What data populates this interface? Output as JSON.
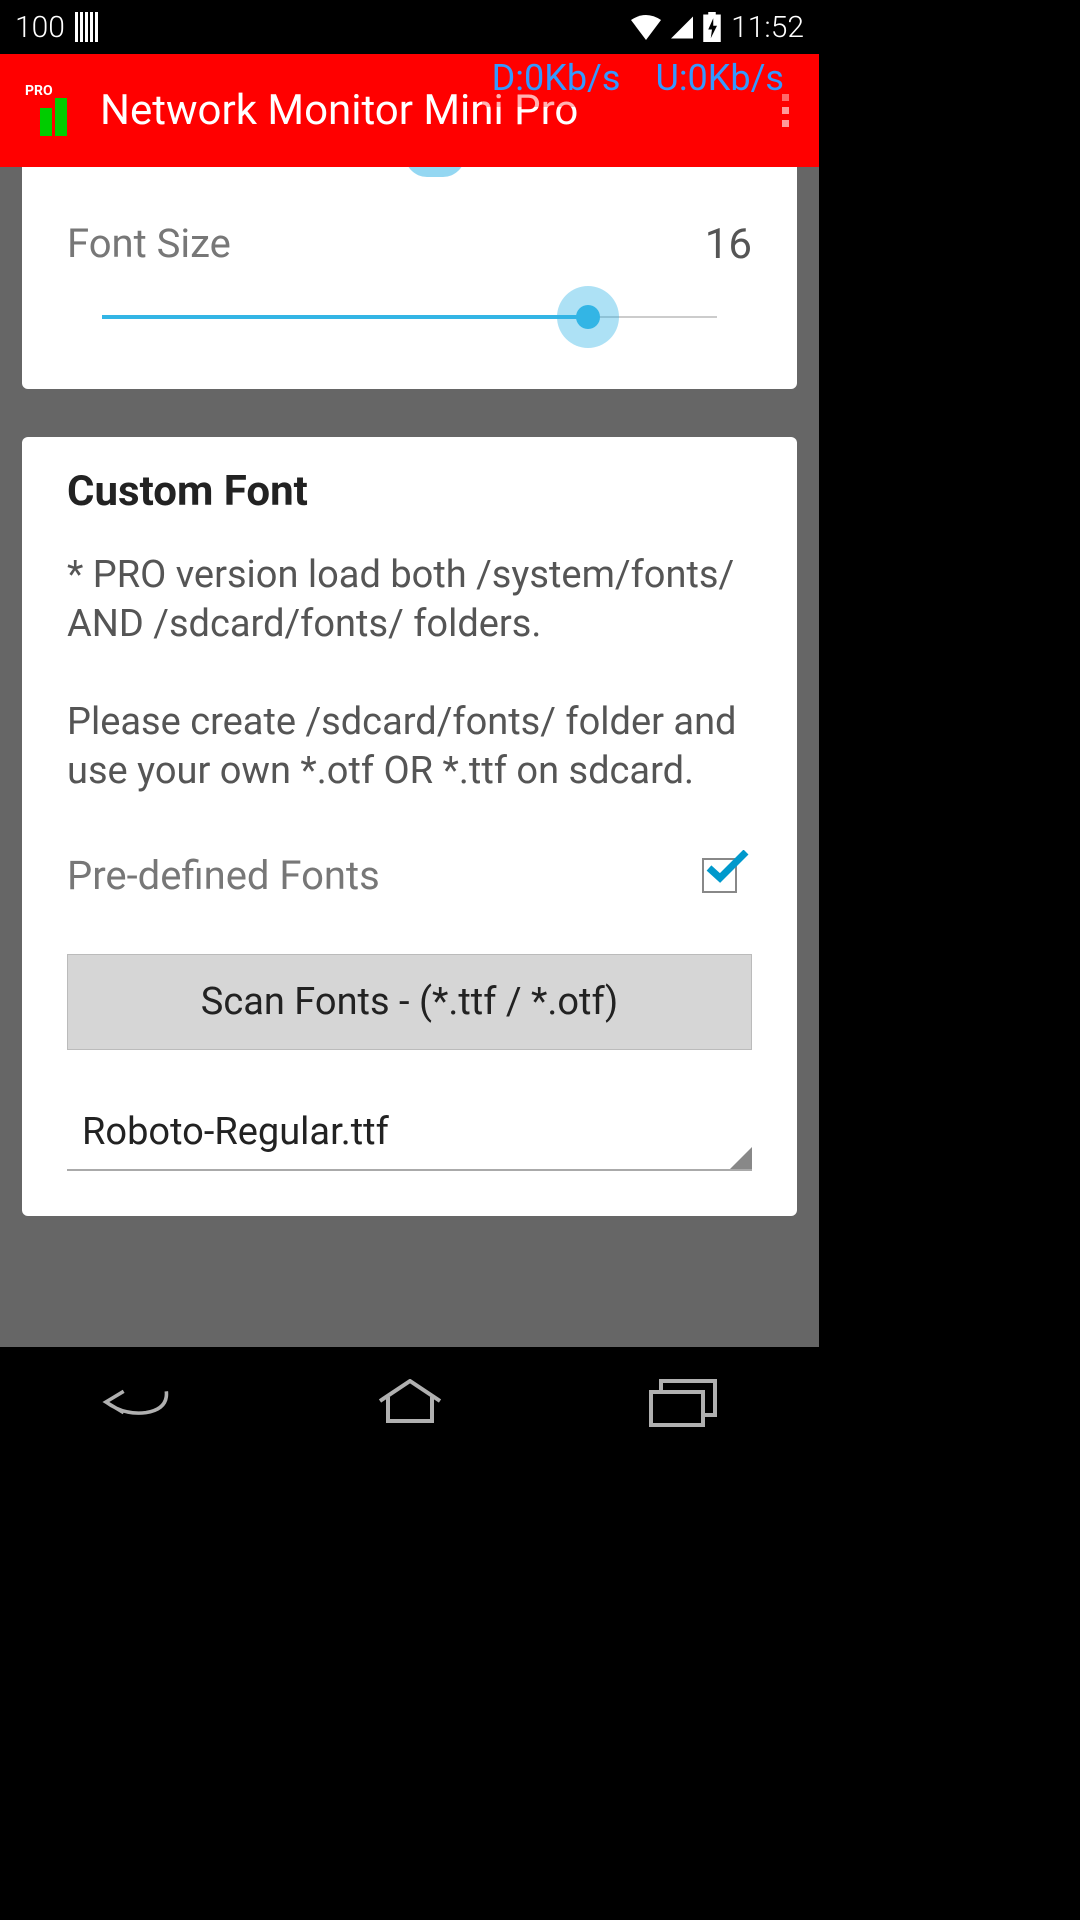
{
  "status_bar": {
    "battery_text": "100",
    "time": "11:52"
  },
  "speed_overlay": {
    "download": "D:0Kb/s",
    "upload": "U:0Kb/s"
  },
  "app_bar": {
    "pro_label": "PRO",
    "title": "Network Monitor Mini Pro"
  },
  "font_size": {
    "label": "Font Size",
    "value": "16"
  },
  "custom_font": {
    "title": "Custom Font",
    "description_line1": "* PRO version load both /system/fonts/ AND /sdcard/fonts/ folders.",
    "description_line2": "Please create /sdcard/fonts/ folder and use your own *.otf OR *.ttf on sdcard.",
    "predefined_label": "Pre-defined Fonts",
    "predefined_checked": true,
    "scan_button_label": "Scan Fonts - (*.ttf / *.otf)",
    "selected_font": "Roboto-Regular.ttf"
  }
}
